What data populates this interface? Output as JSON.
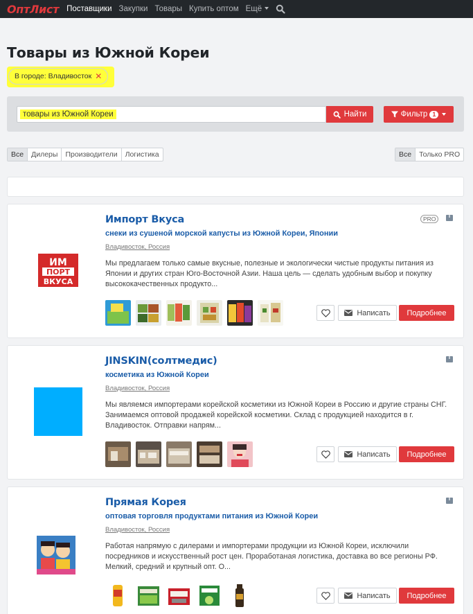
{
  "navbar": {
    "logo": "ОптЛист",
    "items": [
      {
        "label": "Поставщики",
        "active": true
      },
      {
        "label": "Закупки"
      },
      {
        "label": "Товары"
      },
      {
        "label": "Купить оптом"
      },
      {
        "label": "Ещё"
      }
    ],
    "search_icon": "search-icon"
  },
  "page": {
    "title": "Товары из Южной Кореи",
    "city_chip": "В городе: Владивосток"
  },
  "search": {
    "query": "товары из Южной Кореи",
    "find_label": "Найти",
    "filter_label": "Фильтр",
    "filter_count": "1"
  },
  "segments_left": [
    "Все",
    "Дилеры",
    "Производители",
    "Логистика"
  ],
  "segments_right": [
    "Все",
    "Только PRO"
  ],
  "actions": {
    "write_label": "Написать",
    "more_label": "Подробнее",
    "pro_label": "PRO"
  },
  "cards": [
    {
      "title": "Импорт Вкуса",
      "subtitle": "снеки из сушеной морской капусты из Южной Кореи, Японии",
      "location": "Владивосток, Россия",
      "description": "Мы предлагаем только самые вкусные, полезные и экологически чистые продукты питания из Японии и других стран Юго-Восточной Азии. Наша цель — сделать удобным выбор и покупку высококачественных продукто...",
      "pro": true,
      "logo_text": [
        "ИМ",
        "ПОРТ",
        "ВКУСА"
      ]
    },
    {
      "title": "JINSKIN(солтмедис)",
      "subtitle": "косметика из Южной Кореи",
      "location": "Владивосток, Россия",
      "description": "Мы являемся импортерами корейской косметики из Южной Кореи в Россию и другие страны СНГ. Занимаемся оптовой продажей корейской косметики. Склад с продукцией находится в г. Владивосток. Отправки напрям...",
      "pro": false
    },
    {
      "title": "Прямая Корея",
      "subtitle": "оптовая торговля продуктами питания из Южной Кореи",
      "location": "Владивосток, Россия",
      "description": "Работая напрямую с дилерами и импортерами продукции из Южной Кореи, исключили посредников и искусственный рост цен. Проработаная логистика, доставка во все регионы РФ. Мелкий, средний и крупный опт. О...",
      "pro": false
    }
  ],
  "colors": {
    "accent": "#e0393c",
    "link": "#1a5ca8",
    "navbar": "#23272b",
    "highlight": "#ffff3a"
  }
}
